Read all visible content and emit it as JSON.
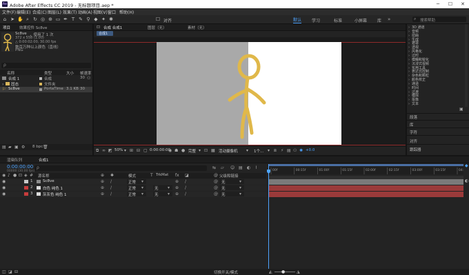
{
  "window": {
    "title": "Adobe After Effects CC 2019 - 无标题项目.aep *",
    "logo": "Ae",
    "controls": [
      "─",
      "☐",
      "✕"
    ]
  },
  "menu": [
    "文件(F)",
    "编辑(E)",
    "合成(C)",
    "图层(L)",
    "效果(T)",
    "动画(A)",
    "视图(V)",
    "窗口",
    "帮助(H)"
  ],
  "toolbar": {
    "snap_label": "对齐",
    "workspaces": [
      "默认",
      "学习",
      "标准",
      "小屏幕",
      "库"
    ],
    "search_placeholder": "搜索帮助"
  },
  "project": {
    "tab": "项目",
    "effect_tab": "效果控件 Sc8ve",
    "selected": {
      "name": "Sc8ve",
      "used": "，使用了 1 次",
      "size": "372 x 558 (1.00)",
      "duration": "△ 0:00:02:00, 30.00 fps",
      "color": "数百万种以上颜色（直线）",
      "format": "PNG"
    },
    "search_placeholder": "ρ",
    "columns": [
      "名称",
      "类型",
      "大小",
      "帧速率"
    ],
    "items": [
      {
        "name": "合成 1",
        "type": "合成",
        "size": "",
        "fps": "30"
      },
      {
        "name": "固态",
        "type": "文件夹",
        "size": "",
        "fps": ""
      },
      {
        "name": "Sc8ve",
        "type": "PortaTime",
        "size": "3.1 KB",
        "fps": "30"
      }
    ],
    "bpc": "8 bpc"
  },
  "viewer": {
    "tabs": [
      "合成 合成1",
      "图层（无）",
      "素材（无）"
    ],
    "comp_chip": "合成1",
    "zoom": "50%",
    "timecode": "0:00:00:00",
    "quality": "完整",
    "camera": "活动摄像机",
    "views": "1个...",
    "exposure": "+0.0"
  },
  "right_panel": {
    "effects": [
      "3D 通道",
      "音频",
      "扭曲",
      "生成",
      "遮罩",
      "透视",
      "风格化",
      "过时",
      "模糊和锐化",
      "沉浸式视频",
      "实用工具",
      "表达式控制",
      "杂色和颗粒",
      "颜色校正",
      "通道",
      "时间",
      "过渡",
      "模拟",
      "抠像",
      "文本"
    ],
    "sections": [
      "段落",
      "库",
      "字符",
      "对齐",
      "跟踪器"
    ]
  },
  "timeline": {
    "tabs": [
      "渲染队列",
      "合成1"
    ],
    "timecode": "0:00:00:00",
    "timecode_sub": "00000 (30.00 fps)",
    "search_placeholder": "ρ",
    "headers": {
      "source": "源名称",
      "mode": "模式",
      "trkmat": "TrkMat",
      "parent": "父级和链接"
    },
    "layers": [
      {
        "num": "1",
        "name": "Sc8ve",
        "mode": "正常",
        "trkmat": "",
        "parent": "无",
        "color": "#c8c8c8",
        "bar": "#7a7a7a"
      },
      {
        "num": "2",
        "name": "白色 纯色 1",
        "mode": "正常",
        "trkmat": "无",
        "parent": "无",
        "color": "#c83c3c",
        "bar": "#9a3a3a"
      },
      {
        "num": "3",
        "name": "灰灰色 纯色 1",
        "mode": "正常",
        "trkmat": "无",
        "parent": "无",
        "color": "#c83c3c",
        "bar": "#9a3a3a"
      }
    ],
    "ruler": [
      "00f",
      "00:15f",
      "01:00f",
      "01:15f",
      "02:00f",
      "02:15f",
      "03:00f",
      "03:15f",
      "04:00f"
    ],
    "switch_label": "切换开关/模式"
  },
  "colors": {
    "accent": "#4ea4ff",
    "figure": "#e0b84a",
    "gray_bg": "#a9a9a9"
  }
}
